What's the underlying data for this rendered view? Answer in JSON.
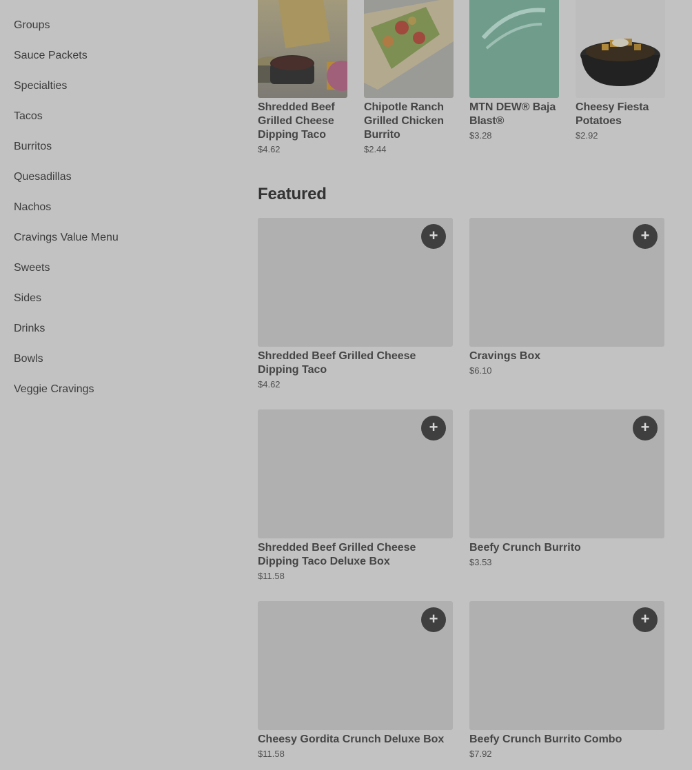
{
  "sidebar": {
    "items": [
      {
        "label": "Groups"
      },
      {
        "label": "Sauce Packets"
      },
      {
        "label": "Specialties"
      },
      {
        "label": "Tacos"
      },
      {
        "label": "Burritos"
      },
      {
        "label": "Quesadillas"
      },
      {
        "label": "Nachos"
      },
      {
        "label": "Cravings Value Menu"
      },
      {
        "label": "Sweets"
      },
      {
        "label": "Sides"
      },
      {
        "label": "Drinks"
      },
      {
        "label": "Bowls"
      },
      {
        "label": "Veggie Cravings"
      }
    ]
  },
  "top_items": [
    {
      "name": "Shredded Beef Grilled Cheese Dipping Taco",
      "price": "$4.62"
    },
    {
      "name": "Chipotle Ranch Grilled Chicken Burrito",
      "price": "$2.44"
    },
    {
      "name": "MTN DEW® Baja Blast®",
      "price": "$3.28"
    },
    {
      "name": "Cheesy Fiesta Potatoes",
      "price": "$2.92"
    }
  ],
  "featured": {
    "title": "Featured",
    "add_symbol": "+",
    "items": [
      {
        "name": "Shredded Beef Grilled Cheese Dipping Taco",
        "price": "$4.62"
      },
      {
        "name": "Cravings Box",
        "price": "$6.10"
      },
      {
        "name": "Shredded Beef Grilled Cheese Dipping Taco Deluxe Box",
        "price": "$11.58"
      },
      {
        "name": "Beefy Crunch Burrito",
        "price": "$3.53"
      },
      {
        "name": "Cheesy Gordita Crunch Deluxe Box",
        "price": "$11.58"
      },
      {
        "name": "Beefy Crunch Burrito Combo",
        "price": "$7.92"
      }
    ]
  },
  "colors": {
    "overlay_background": "#c2c2c2",
    "placeholder_image": "#b0b0b0",
    "add_button": "#3f3f3f"
  }
}
